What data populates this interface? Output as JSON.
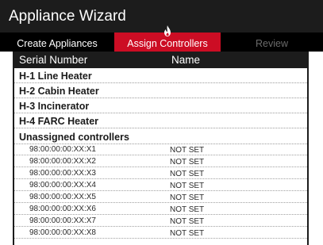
{
  "window": {
    "title": "Appliance Wizard"
  },
  "tabs": [
    {
      "label": "Create Appliances",
      "state": "inactive"
    },
    {
      "label": "Assign Controllers",
      "state": "active",
      "icon": "flame-icon"
    },
    {
      "label": "Review",
      "state": "disabled"
    }
  ],
  "colors": {
    "active_tab": "#cc0d24",
    "header": "#1c1c1c"
  },
  "table": {
    "columns": [
      "Serial Number",
      "Name"
    ],
    "appliances": [
      "H-1 Line Heater",
      "H-2 Cabin Heater",
      "H-3 Incinerator",
      "H-4 FARC Heater"
    ],
    "unassigned_label": "Unassigned controllers",
    "controllers": [
      {
        "serial": "98:00:00:00:XX:X1",
        "name": "NOT SET"
      },
      {
        "serial": "98:00:00:00:XX:X2",
        "name": "NOT SET"
      },
      {
        "serial": "98:00:00:00:XX:X3",
        "name": "NOT SET"
      },
      {
        "serial": "98:00:00:00:XX:X4",
        "name": "NOT SET"
      },
      {
        "serial": "98:00:00:00:XX:X5",
        "name": "NOT SET"
      },
      {
        "serial": "98:00:00:00:XX:X6",
        "name": "NOT SET"
      },
      {
        "serial": "98:00:00:00:XX:X7",
        "name": "NOT SET"
      },
      {
        "serial": "98:00:00:00:XX:X8",
        "name": "NOT SET"
      }
    ]
  }
}
